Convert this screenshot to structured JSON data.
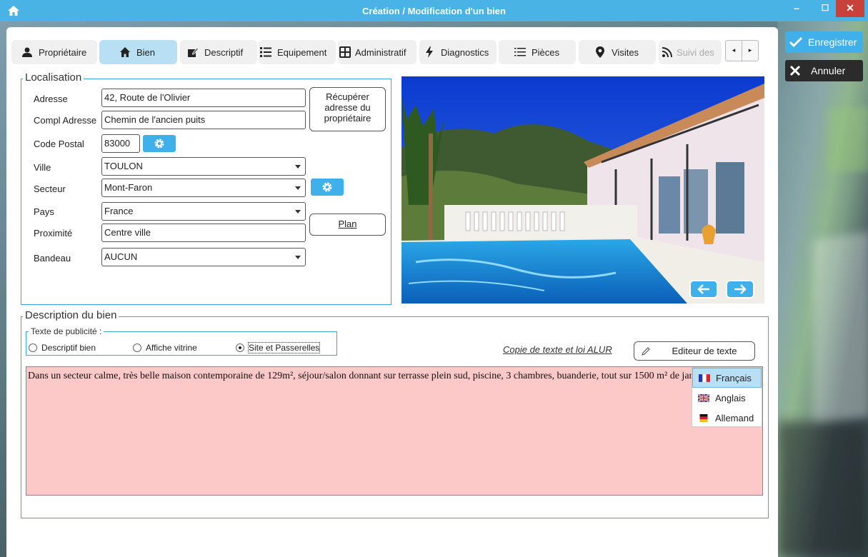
{
  "window": {
    "title": "Création / Modification d'un bien",
    "min": "–",
    "max": "☐",
    "close": "✕"
  },
  "tabs": [
    {
      "label": "Propriétaire",
      "icon": "user-icon"
    },
    {
      "label": "Bien",
      "icon": "home-icon",
      "active": true
    },
    {
      "label": "Descriptif",
      "icon": "edit-icon"
    },
    {
      "label": "Equipement",
      "icon": "list-icon"
    },
    {
      "label": "Administratif",
      "icon": "calculator-icon"
    },
    {
      "label": "Diagnostics",
      "icon": "bolt-icon"
    },
    {
      "label": "Pièces",
      "icon": "list-lines-icon"
    },
    {
      "label": "Visites",
      "icon": "map-marker-icon"
    },
    {
      "label": "Suivi des",
      "icon": "rss-icon"
    }
  ],
  "tab_arrows": {
    "left": "◂",
    "right": "▸"
  },
  "actions": {
    "save": "Enregistrer",
    "cancel": "Annuler"
  },
  "localisation": {
    "legend": "Localisation",
    "adresse_label": "Adresse",
    "adresse": "42, Route de l'Olivier",
    "compl_label": "Compl Adresse",
    "compl": "Chemin de l'ancien puits",
    "cp_label": "Code Postal",
    "cp": "83000",
    "ville_label": "Ville",
    "ville": "TOULON",
    "secteur_label": "Secteur",
    "secteur": "Mont-Faron",
    "pays_label": "Pays",
    "pays": "France",
    "proximite_label": "Proximité",
    "proximite": "Centre ville",
    "bandeau_label": "Bandeau",
    "bandeau": "AUCUN",
    "recup_btn": "Récupérer adresse du propriétaire",
    "plan_btn": "Plan"
  },
  "description": {
    "legend": "Description du bien",
    "pub_legend": "Texte de publicité :",
    "radios": [
      "Descriptif bien",
      "Affiche vitrine",
      "Site et Passerelles"
    ],
    "selected_radio": "Site et Passerelles",
    "alur_link": "Copie de texte et loi ALUR",
    "editor_btn": "Editeur de texte",
    "text": "Dans un secteur calme, très belle maison contemporaine de 129m², séjour/salon donnant sur terrasse plein sud, piscine, 3 chambres, buanderie, tout sur 1500 m² de jardin paysagé.",
    "languages": [
      {
        "label": "Français",
        "selected": true
      },
      {
        "label": "Anglais"
      },
      {
        "label": "Allemand"
      }
    ]
  },
  "colors": {
    "accent": "#3fb0ea",
    "titlebar": "#4ab3e6",
    "active_tab": "#b9dff5",
    "text_bg": "#fdc8c8"
  }
}
